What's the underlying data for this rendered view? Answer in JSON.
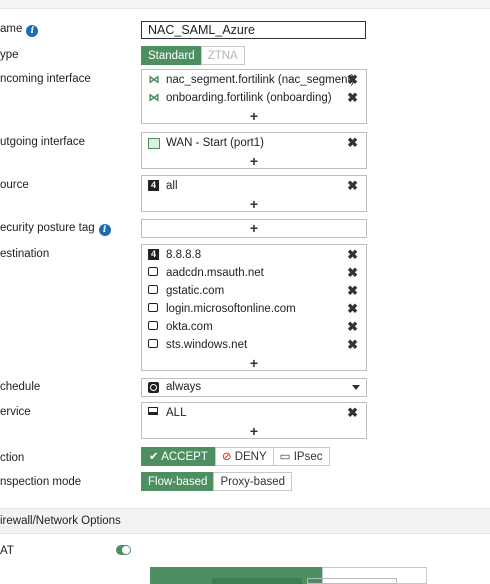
{
  "labels": {
    "name": "ame",
    "type": "ype",
    "incoming": "ncoming interface",
    "outgoing": "utgoing interface",
    "source": "ource",
    "posture": "ecurity posture tag",
    "destination": "estination",
    "schedule": "chedule",
    "service": "ervice",
    "action": "ction",
    "inspection": "nspection mode",
    "nat": "AT",
    "info_glyph": "i"
  },
  "name_value": "NAC_SAML_Azure",
  "type_options": [
    "Standard",
    "ZTNA"
  ],
  "type_selected": "Standard",
  "incoming": [
    "nac_segment.fortilink (nac_segment)",
    "onboarding.fortilink (onboarding)"
  ],
  "outgoing": [
    "WAN - Start (port1)"
  ],
  "source": [
    "all"
  ],
  "destination": [
    {
      "label": "8.8.8.8",
      "icon": "address-icon"
    },
    {
      "label": "aadcdn.msauth.net",
      "icon": "fqdn-icon"
    },
    {
      "label": "gstatic.com",
      "icon": "fqdn-icon"
    },
    {
      "label": "login.microsoftonline.com",
      "icon": "fqdn-icon"
    },
    {
      "label": "okta.com",
      "icon": "fqdn-icon"
    },
    {
      "label": "sts.windows.net",
      "icon": "fqdn-icon"
    }
  ],
  "schedule_value": "always",
  "service": [
    "ALL"
  ],
  "action": {
    "accept": "ACCEPT",
    "deny": "DENY",
    "ipsec": "IPsec",
    "accept_check": "✔",
    "deny_glyph": "⃠"
  },
  "inspection": {
    "flow": "Flow-based",
    "proxy": "Proxy-based"
  },
  "section_title": "irewall/Network Options",
  "glyphs": {
    "remove": "✖",
    "add": "+",
    "address": "4",
    "interface": "⋈"
  },
  "colors": {
    "accent": "#4d8f60",
    "info": "#1e6bb8",
    "deny": "#cc2222"
  }
}
